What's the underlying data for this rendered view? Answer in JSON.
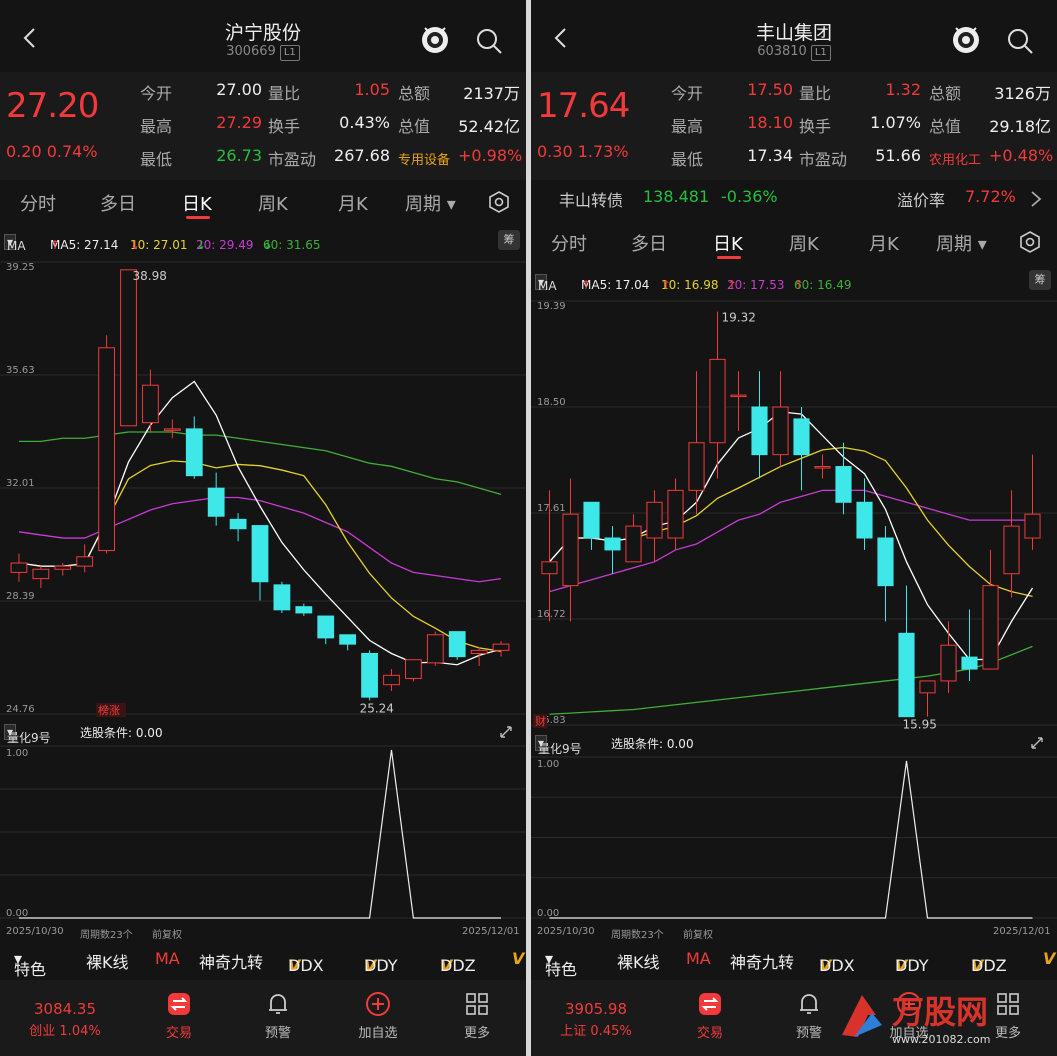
{
  "left": {
    "title": "沪宁股份",
    "code": "300669",
    "level": "L1",
    "price": "27.20",
    "change": "0.20 0.74%",
    "quote_rows": [
      [
        "今开",
        "27.00",
        "量比",
        "1.05",
        "总额",
        "2137万"
      ],
      [
        "最高",
        "27.29",
        "换手",
        "0.43%",
        "总值",
        "52.42亿"
      ],
      [
        "最低",
        "26.73",
        "市盈动",
        "267.68",
        "专用设备",
        "+0.98%"
      ]
    ],
    "tabs": [
      "分时",
      "多日",
      "日K",
      "周K",
      "月K",
      "周期"
    ],
    "ma": {
      "sel": "MA",
      "ma5": "MA5: 27.14",
      "ma10": "10: 27.01",
      "ma20": "20: 29.49",
      "ma60": "60: 31.65"
    },
    "chip_btn": "筹",
    "y_labels": [
      "39.25",
      "35.63",
      "32.01",
      "28.39",
      "24.76"
    ],
    "hi_label": "38.98",
    "lo_label": "25.24",
    "badge": "榜涨",
    "indicator": {
      "sel": "量化9号",
      "cond": "选股条件: 0.00",
      "top": "1.00",
      "bottom": "0.00"
    },
    "dates": {
      "start": "2025/10/30",
      "count": "周期数23个",
      "adj": "前复权",
      "end": "2025/12/01"
    },
    "toolbar": [
      "特色",
      "裸K线",
      "MA",
      "神奇九转",
      "DDX",
      "DDY",
      "DDZ",
      "V"
    ],
    "nav": {
      "idx_val": "3084.35",
      "idx_sub": "创业 1.04%",
      "items": [
        "交易",
        "预警",
        "加自选",
        "更多"
      ]
    }
  },
  "right": {
    "title": "丰山集团",
    "code": "603810",
    "level": "L1",
    "price": "17.64",
    "change": "0.30 1.73%",
    "quote_rows": [
      [
        "今开",
        "17.50",
        "量比",
        "1.32",
        "总额",
        "3126万"
      ],
      [
        "最高",
        "18.10",
        "换手",
        "1.07%",
        "总值",
        "29.18亿"
      ],
      [
        "最低",
        "17.34",
        "市盈动",
        "51.66",
        "农用化工",
        "+0.48%"
      ]
    ],
    "bond": {
      "name": "丰山转债",
      "price": "138.481",
      "pct": "-0.36%",
      "premium_lbl": "溢价率",
      "premium": "7.72%"
    },
    "tabs": [
      "分时",
      "多日",
      "日K",
      "周K",
      "月K",
      "周期"
    ],
    "ma": {
      "sel": "MA",
      "ma5": "MA5: 17.04",
      "ma10": "10: 16.98",
      "ma20": "20: 17.53",
      "ma60": "60: 16.49"
    },
    "chip_btn": "筹",
    "y_labels": [
      "19.39",
      "18.50",
      "17.61",
      "16.72",
      "15.83"
    ],
    "hi_label": "19.32",
    "lo_label": "15.95",
    "badge": "财",
    "indicator": {
      "sel": "量化9号",
      "cond": "选股条件: 0.00",
      "top": "1.00",
      "bottom": "0.00"
    },
    "dates": {
      "start": "2025/10/30",
      "count": "周期数23个",
      "adj": "前复权",
      "end": "2025/12/01"
    },
    "toolbar": [
      "特色",
      "裸K线",
      "MA",
      "神奇九转",
      "DDX",
      "DDY",
      "DDZ",
      "V"
    ],
    "nav": {
      "idx_val": "3905.98",
      "idx_sub": "上证 0.45%",
      "items": [
        "交易",
        "预警",
        "加自选",
        "更多"
      ]
    }
  },
  "watermark": {
    "brand": "万股网",
    "url": "www.201082.com"
  },
  "colors": {
    "up": "#f23a3a",
    "down": "#3ee8e8",
    "ma5": "#ffffff",
    "ma10": "#e6d22a",
    "ma20": "#c93ad6",
    "ma60": "#3fae3a"
  },
  "chart_data": [
    {
      "type": "candlestick",
      "title": "沪宁股份",
      "ylim": [
        24.76,
        39.25
      ],
      "candles": [
        [
          29.3,
          29.9,
          29.0,
          29.6
        ],
        [
          29.1,
          29.5,
          28.8,
          29.4
        ],
        [
          29.4,
          29.6,
          29.2,
          29.5
        ],
        [
          29.5,
          30.2,
          29.3,
          29.8
        ],
        [
          30.0,
          36.9,
          29.9,
          36.5
        ],
        [
          34.0,
          39.0,
          34.0,
          39.0
        ],
        [
          34.1,
          35.8,
          33.8,
          35.3
        ],
        [
          33.9,
          34.2,
          33.6,
          33.9
        ],
        [
          33.9,
          34.3,
          32.3,
          32.4
        ],
        [
          32.0,
          32.5,
          30.8,
          31.1
        ],
        [
          31.0,
          31.2,
          30.3,
          30.7
        ],
        [
          30.8,
          30.8,
          28.4,
          29.0
        ],
        [
          28.9,
          29.0,
          28.0,
          28.1
        ],
        [
          28.2,
          28.3,
          27.9,
          28.0
        ],
        [
          27.9,
          27.9,
          27.0,
          27.2
        ],
        [
          27.3,
          27.3,
          26.8,
          27.0
        ],
        [
          26.7,
          26.8,
          25.2,
          25.3
        ],
        [
          25.7,
          26.2,
          25.5,
          26.0
        ],
        [
          25.9,
          26.5,
          25.8,
          26.5
        ],
        [
          26.4,
          27.4,
          26.3,
          27.3
        ],
        [
          27.4,
          27.4,
          26.5,
          26.6
        ],
        [
          26.7,
          26.9,
          26.3,
          26.8
        ],
        [
          26.8,
          27.1,
          26.6,
          27.0
        ]
      ],
      "signal": [
        0,
        0,
        0,
        0,
        0,
        0,
        0,
        0,
        0,
        0,
        0,
        0,
        0,
        0,
        0,
        0,
        0,
        1,
        0,
        0,
        0,
        0,
        0
      ]
    },
    {
      "type": "candlestick",
      "title": "丰山集团",
      "ylim": [
        15.83,
        19.39
      ],
      "candles": [
        [
          17.1,
          17.8,
          16.7,
          17.2
        ],
        [
          17.0,
          17.9,
          16.7,
          17.6
        ],
        [
          17.7,
          17.7,
          17.3,
          17.4
        ],
        [
          17.4,
          17.5,
          17.1,
          17.3
        ],
        [
          17.2,
          17.6,
          17.2,
          17.5
        ],
        [
          17.4,
          17.8,
          17.2,
          17.7
        ],
        [
          17.4,
          17.9,
          17.3,
          17.8
        ],
        [
          17.8,
          18.8,
          17.6,
          18.2
        ],
        [
          18.2,
          19.3,
          17.9,
          18.9
        ],
        [
          18.6,
          18.8,
          18.3,
          18.6
        ],
        [
          18.5,
          18.8,
          17.9,
          18.1
        ],
        [
          18.1,
          18.8,
          18.0,
          18.5
        ],
        [
          18.4,
          18.5,
          17.8,
          18.1
        ],
        [
          18.0,
          18.1,
          17.9,
          18.0
        ],
        [
          18.0,
          18.2,
          17.6,
          17.7
        ],
        [
          17.7,
          17.9,
          17.3,
          17.4
        ],
        [
          17.4,
          17.5,
          16.7,
          17.0
        ],
        [
          16.6,
          17.0,
          15.9,
          15.9
        ],
        [
          16.1,
          16.2,
          15.9,
          16.2
        ],
        [
          16.2,
          16.7,
          16.1,
          16.5
        ],
        [
          16.4,
          16.8,
          16.2,
          16.3
        ],
        [
          16.3,
          17.3,
          16.3,
          17.0
        ],
        [
          17.1,
          17.8,
          16.9,
          17.5
        ],
        [
          17.4,
          18.1,
          17.3,
          17.6
        ]
      ],
      "signal": [
        0,
        0,
        0,
        0,
        0,
        0,
        0,
        0,
        0,
        0,
        0,
        0,
        0,
        0,
        0,
        0,
        0,
        1,
        0,
        0,
        0,
        0,
        0,
        0
      ]
    }
  ]
}
